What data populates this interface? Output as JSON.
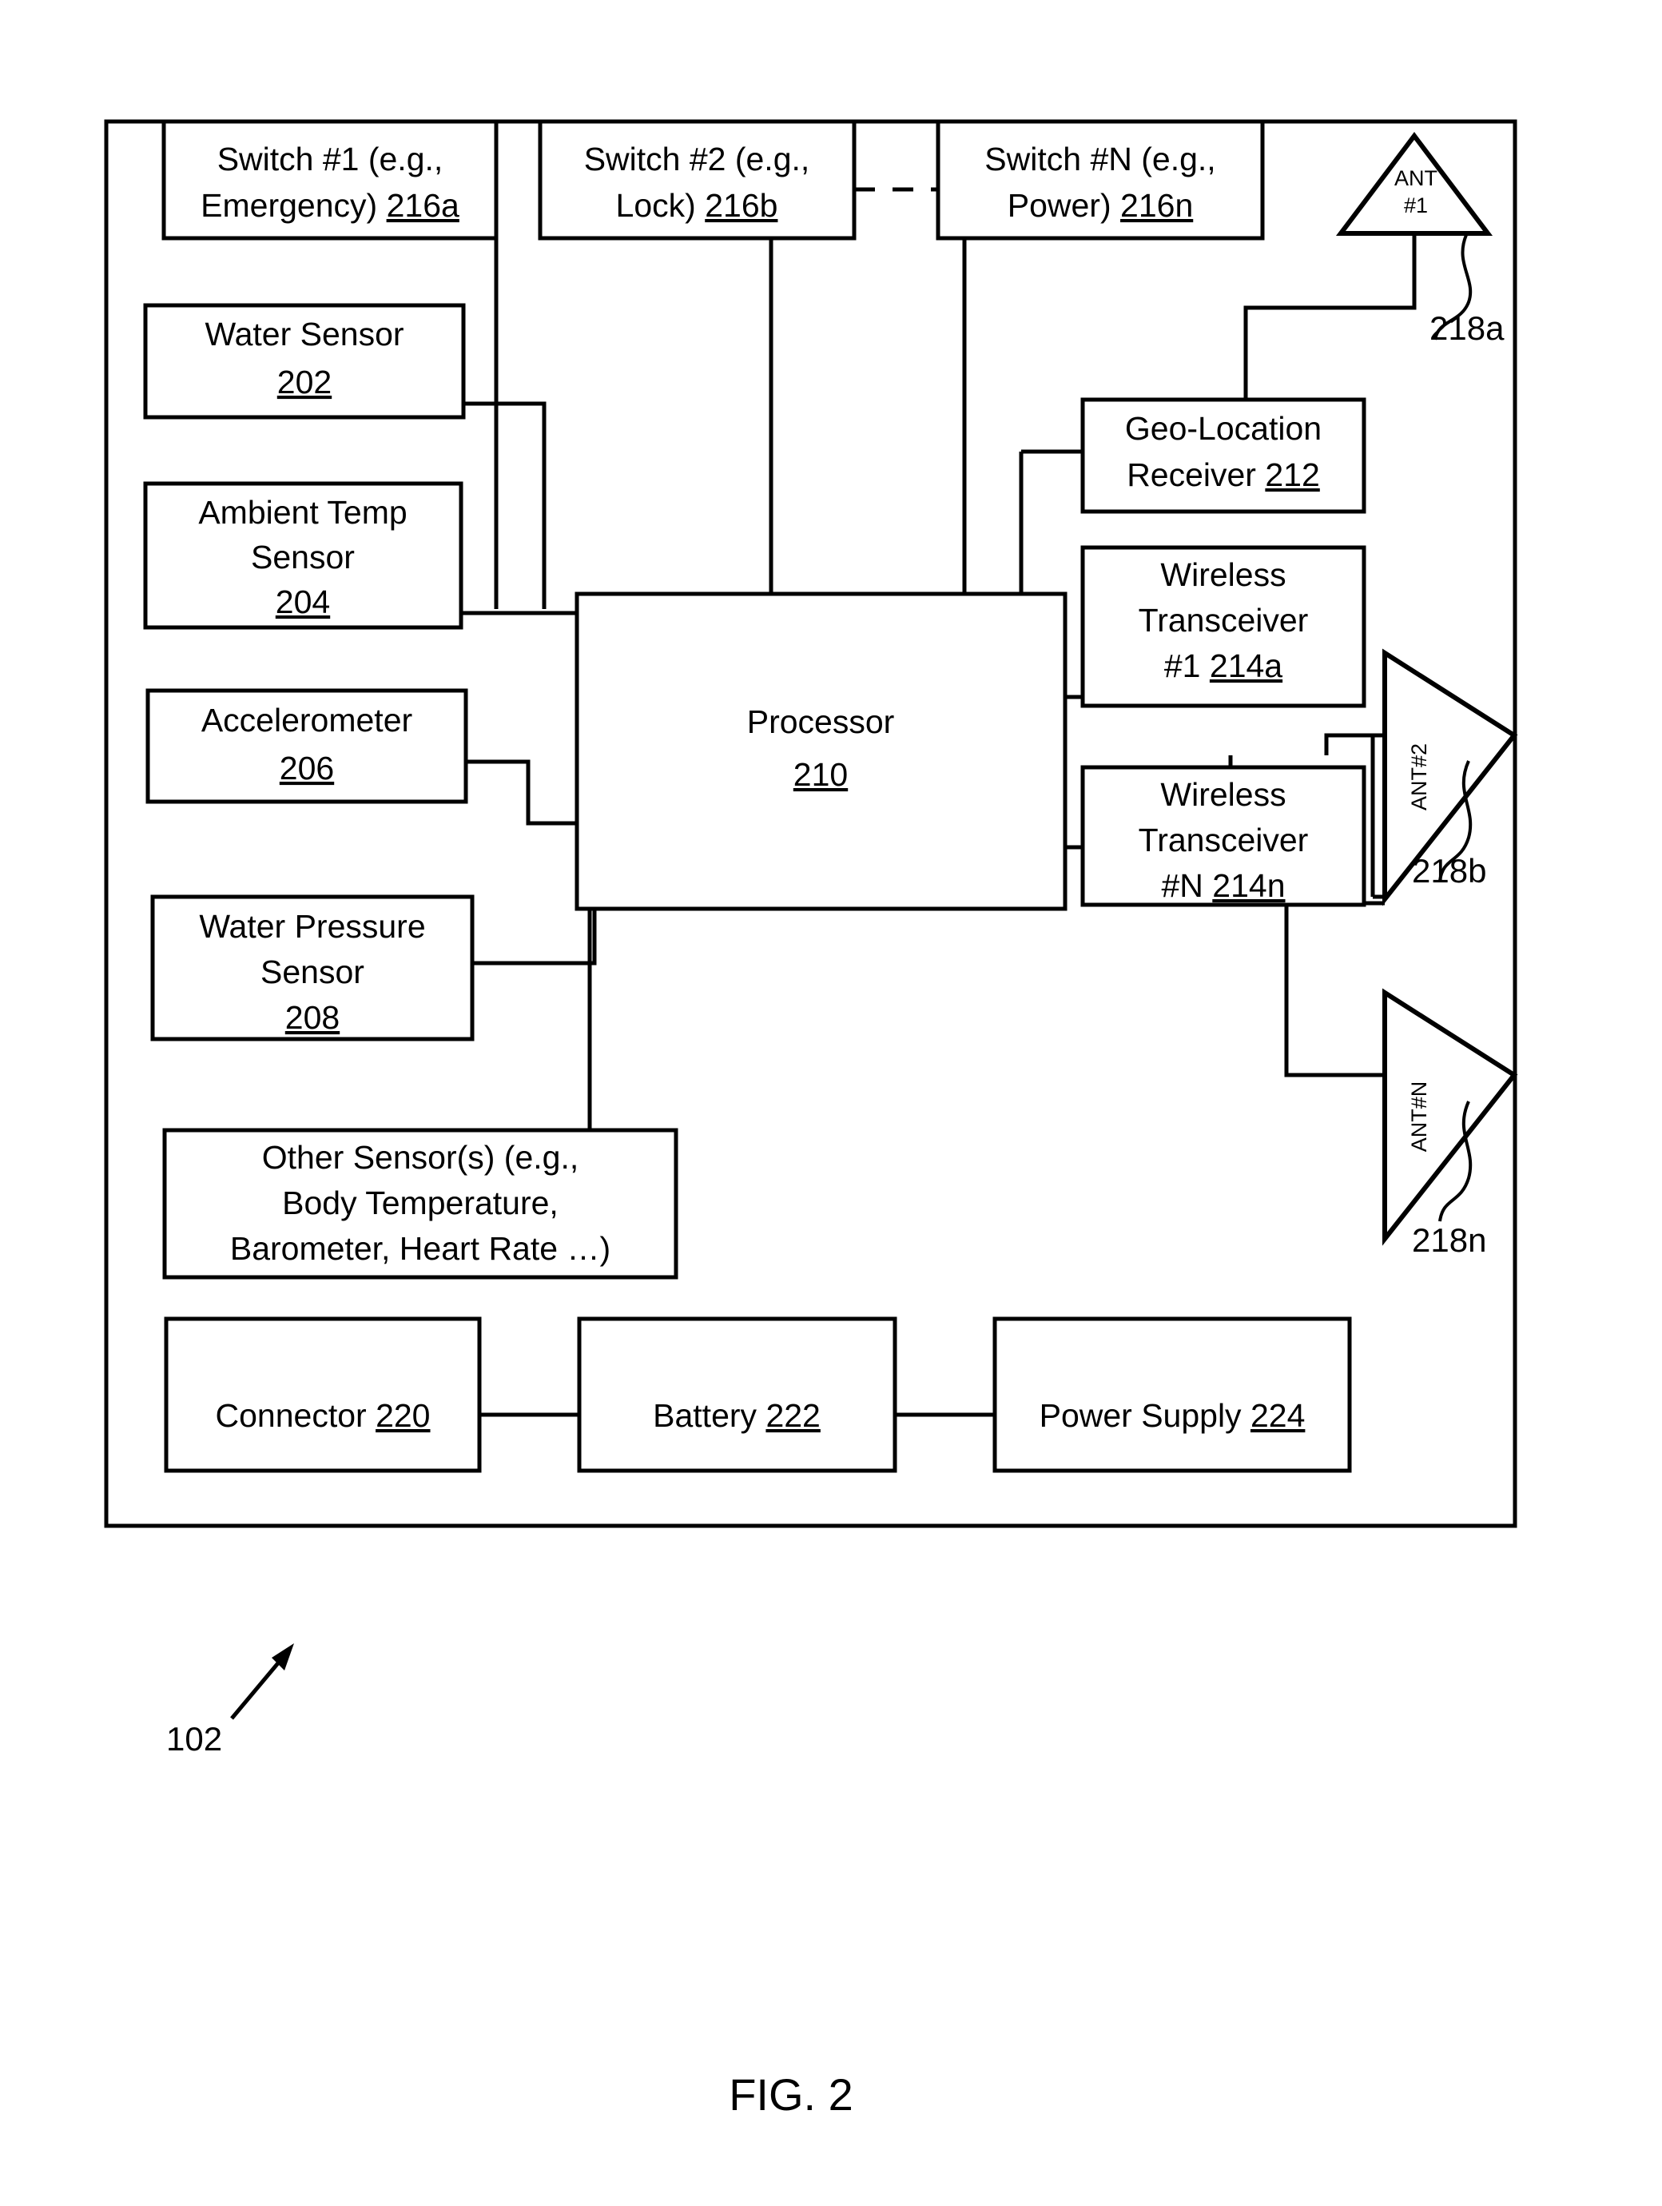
{
  "figure": {
    "caption": "FIG. 2",
    "device_ref": "102"
  },
  "boxes": {
    "switch1": {
      "line1": "Switch #1 (e.g.,",
      "line2_text": "Emergency)",
      "line2_ref": "216a"
    },
    "switch2": {
      "line1": "Switch #2 (e.g.,",
      "line2_text": "Lock)",
      "line2_ref": "216b"
    },
    "switchN": {
      "line1": "Switch #N (e.g.,",
      "line2_text": "Power)",
      "line2_ref": "216n"
    },
    "water_sensor": {
      "line1": "Water Sensor",
      "ref": "202"
    },
    "ambient_temp": {
      "line1": "Ambient Temp",
      "line2": "Sensor",
      "ref": "204"
    },
    "accelerometer": {
      "line1": "Accelerometer",
      "ref": "206"
    },
    "water_pressure": {
      "line1": "Water Pressure",
      "line2": "Sensor",
      "ref": "208"
    },
    "other_sensors": {
      "line1": "Other Sensor(s) (e.g.,",
      "line2": "Body Temperature,",
      "line3": "Barometer, Heart Rate …)"
    },
    "processor": {
      "line1": "Processor",
      "ref": "210"
    },
    "geo_location": {
      "line1": "Geo-Location",
      "line2_text": "Receiver",
      "line2_ref": "212"
    },
    "transceiver1": {
      "line1": "Wireless",
      "line2": "Transceiver",
      "line3_text": "#1",
      "line3_ref": "214a"
    },
    "transceiverN": {
      "line1": "Wireless",
      "line2": "Transceiver",
      "line3_text": "#N",
      "line3_ref": "214n"
    },
    "connector": {
      "text": "Connector",
      "ref": "220"
    },
    "battery": {
      "text": "Battery",
      "ref": "222"
    },
    "power_supply": {
      "text": "Power Supply",
      "ref": "224"
    }
  },
  "antennas": {
    "ant1": {
      "label_line1": "ANT",
      "label_line2": "#1",
      "ref": "218a"
    },
    "ant2": {
      "label": "ANT#2",
      "ref": "218b"
    },
    "antN": {
      "label": "ANT#N",
      "ref": "218n"
    }
  },
  "colors": {
    "ink": "#000000",
    "paper": "#ffffff"
  }
}
